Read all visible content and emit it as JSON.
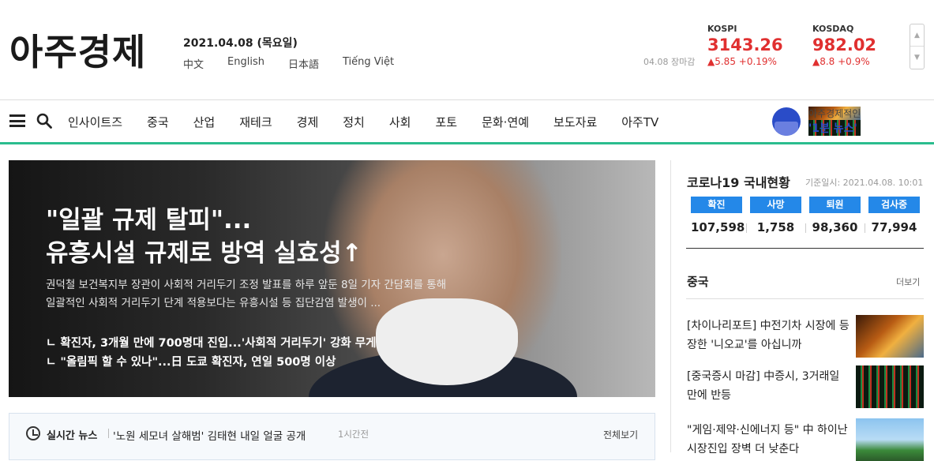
{
  "header": {
    "logo": "아주경제",
    "date": "2021.04.08 (목요일)",
    "languages": [
      "中文",
      "English",
      "日本語",
      "Tiếng Việt"
    ],
    "market_time": "04.08 장마감",
    "kospi": {
      "name": "KOSPI",
      "value": "3143.26",
      "change": "▲5.85 +0.19%"
    },
    "kosdaq": {
      "name": "KOSDAQ",
      "value": "982.02",
      "change": "▲8.8 +0.9%"
    },
    "scroll_up": "▲",
    "scroll_down": "▼"
  },
  "nav": {
    "items": [
      "인사이트즈",
      "중국",
      "산업",
      "재테크",
      "경제",
      "정치",
      "사회",
      "포토",
      "문화·연예",
      "보도자료",
      "아주TV"
    ],
    "one_min_label": "아주경제적인",
    "one_min_title": "'1분 뉴스'"
  },
  "hero": {
    "headline_1": "\"일괄 규제 탈피\"...",
    "headline_2": "유흥시설 규제로 방역 실효성↑",
    "desc": "권덕철 보건복지부 장관이 사회적 거리두기 조정 발표를 하루 앞둔 8일 기자 간담회를 통해 일괄적인 사회적 거리두기 단계 적용보다는 유흥시설 등 집단감염 발생이 ...",
    "related_1": "ㄴ 확진자, 3개월 만에 700명대 진입...'사회적 거리두기' 강화 무게",
    "related_2": "ㄴ \"올림픽 할 수 있나\"...日 도쿄 확진자, 연일 500명 이상"
  },
  "realtime": {
    "label": "실시간 뉴스",
    "headline": "'노원 세모녀 살해범' 김태현 내일 얼굴 공개",
    "time": "1시간전",
    "view_all": "전체보기"
  },
  "covid": {
    "title": "코로나19 국내현황",
    "date": "기준일시: 2021.04.08. 10:01",
    "stats": [
      {
        "label": "확진",
        "value": "107,598"
      },
      {
        "label": "사망",
        "value": "1,758"
      },
      {
        "label": "퇴원",
        "value": "98,360"
      },
      {
        "label": "검사중",
        "value": "77,994"
      }
    ]
  },
  "china": {
    "title": "중국",
    "more": "더보기",
    "news": [
      "[차이나리포트] 中전기차 시장에 등장한 '니오교'를 아십니까",
      "[중국증시 마감] 中증시, 3거래일 만에 반등",
      "\"게임·제약·신에너지 등\" 中 하이난 시장진입 장벽 더 낮춘다"
    ]
  }
}
